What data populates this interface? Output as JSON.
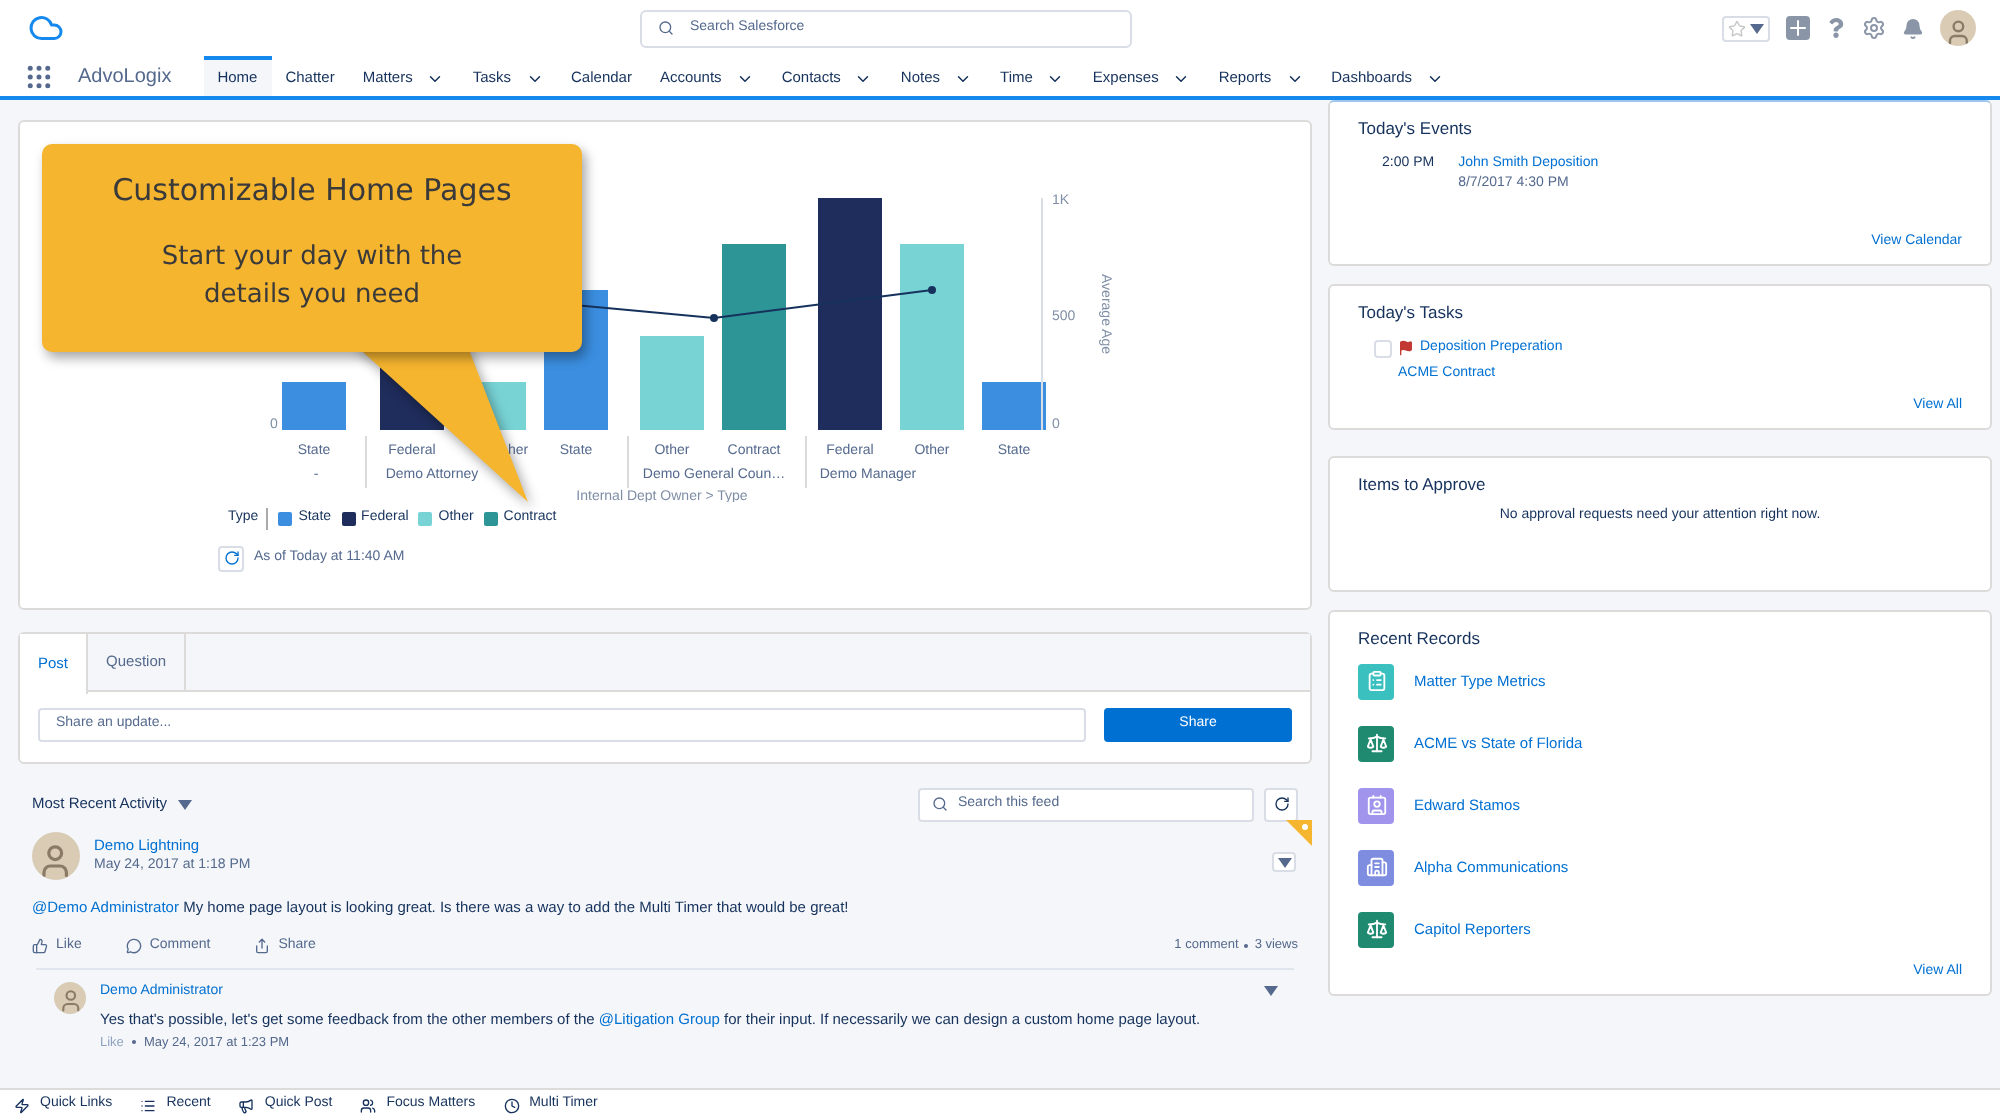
{
  "header": {
    "search_placeholder": "Search Salesforce"
  },
  "app_name": "AdvoLogix",
  "nav_tabs": [
    {
      "label": "Home",
      "selected": true,
      "menu": false
    },
    {
      "label": "Chatter",
      "selected": false,
      "menu": false
    },
    {
      "label": "Matters",
      "selected": false,
      "menu": true
    },
    {
      "label": "Tasks",
      "selected": false,
      "menu": true
    },
    {
      "label": "Calendar",
      "selected": false,
      "menu": false
    },
    {
      "label": "Accounts",
      "selected": false,
      "menu": true
    },
    {
      "label": "Contacts",
      "selected": false,
      "menu": true
    },
    {
      "label": "Notes",
      "selected": false,
      "menu": true
    },
    {
      "label": "Time",
      "selected": false,
      "menu": true
    },
    {
      "label": "Expenses",
      "selected": false,
      "menu": true
    },
    {
      "label": "Reports",
      "selected": false,
      "menu": true
    },
    {
      "label": "Dashboards",
      "selected": false,
      "menu": true
    }
  ],
  "chart": {
    "bars": [
      {
        "label": "State",
        "kind": "state"
      },
      {
        "label": "Federal",
        "kind": "federal"
      },
      {
        "label": "her",
        "kind": "other"
      },
      {
        "label": "State",
        "kind": "state"
      },
      {
        "label": "Other",
        "kind": "other"
      },
      {
        "label": "Contract",
        "kind": "contract"
      },
      {
        "label": "Federal",
        "kind": "federal"
      },
      {
        "label": "Other",
        "kind": "other"
      },
      {
        "label": "State",
        "kind": "state"
      }
    ],
    "groups": [
      "-",
      "Demo Attorney",
      "Demo General Coun…",
      "Demo Manager"
    ],
    "xlabel": "Internal Dept Owner > Type",
    "left_tick": "0",
    "right_ticks": [
      "1K",
      "500",
      "0"
    ],
    "right_label": "Average Age",
    "legend_title": "Type",
    "legend": [
      {
        "label": "State",
        "kind": "state",
        "color": "#3b8ee0"
      },
      {
        "label": "Federal",
        "kind": "federal",
        "color": "#1f2d5c"
      },
      {
        "label": "Other",
        "kind": "other",
        "color": "#78d3d5"
      },
      {
        "label": "Contract",
        "kind": "contract",
        "color": "#2d9596"
      }
    ],
    "as_of": "As of Today at 11:40 AM"
  },
  "callout": {
    "title": "Customizable Home Pages",
    "text": "Start your day with the details you need"
  },
  "publisher": {
    "tabs": [
      {
        "label": "Post",
        "selected": true
      },
      {
        "label": "Question",
        "selected": false
      }
    ],
    "placeholder": "Share an update...",
    "button": "Share"
  },
  "feed": {
    "sort": "Most Recent Activity",
    "search_placeholder": "Search this feed",
    "post": {
      "author": "Demo Lightning",
      "date": "May 24, 2017 at 1:18 PM",
      "bookmarked": true,
      "body": [
        {
          "text": "@Demo Administrator",
          "link": true
        },
        {
          "text": " My home page layout is looking great. Is there was a way to add the Multi Timer that would be great!",
          "link": false
        }
      ],
      "actions": [
        {
          "label": "Like",
          "kind": "like"
        },
        {
          "label": "Comment",
          "kind": "comment"
        },
        {
          "label": "Share",
          "kind": "share"
        }
      ],
      "comments_count": "1 comment",
      "views": "3 views"
    },
    "comment": {
      "author": "Demo Administrator",
      "body": [
        {
          "text": "Yes that's possible, let's get some feedback from the other members of the ",
          "link": false
        },
        {
          "text": "@Litigation Group",
          "link": true
        },
        {
          "text": " for their input. If necessarily we can design a custom home page layout.",
          "link": false
        }
      ],
      "like": "Like",
      "date": "May 24, 2017 at 1:23 PM"
    }
  },
  "events": {
    "title": "Today's Events",
    "items": [
      {
        "time": "2:00 PM",
        "name": "John Smith Deposition",
        "when": "8/7/2017 4:30 PM"
      }
    ],
    "link": "View Calendar"
  },
  "tasks": {
    "title": "Today's Tasks",
    "items": [
      {
        "name": "Deposition Preperation",
        "related": "ACME Contract",
        "checked": false,
        "flagged": true
      }
    ],
    "link": "View All"
  },
  "approvals": {
    "title": "Items to Approve",
    "empty": "No approval requests need your attention right now."
  },
  "records": {
    "title": "Recent Records",
    "items": [
      {
        "name": "Matter Type Metrics",
        "kind": "clipboard",
        "color": "#3bc0c0"
      },
      {
        "name": "ACME vs State of Florida",
        "kind": "scales",
        "color": "#1f8a70"
      },
      {
        "name": "Edward Stamos",
        "kind": "contact",
        "color": "#a094ed"
      },
      {
        "name": "Alpha Communications",
        "kind": "building",
        "color": "#7f8de1"
      },
      {
        "name": "Capitol Reporters",
        "kind": "scales",
        "color": "#1f8a70"
      }
    ],
    "link": "View All"
  },
  "utility_bar": [
    {
      "label": "Quick Links",
      "kind": "bolt"
    },
    {
      "label": "Recent",
      "kind": "list"
    },
    {
      "label": "Quick Post",
      "kind": "megaphone"
    },
    {
      "label": "Focus Matters",
      "kind": "users"
    },
    {
      "label": "Multi Timer",
      "kind": "clock"
    }
  ]
}
